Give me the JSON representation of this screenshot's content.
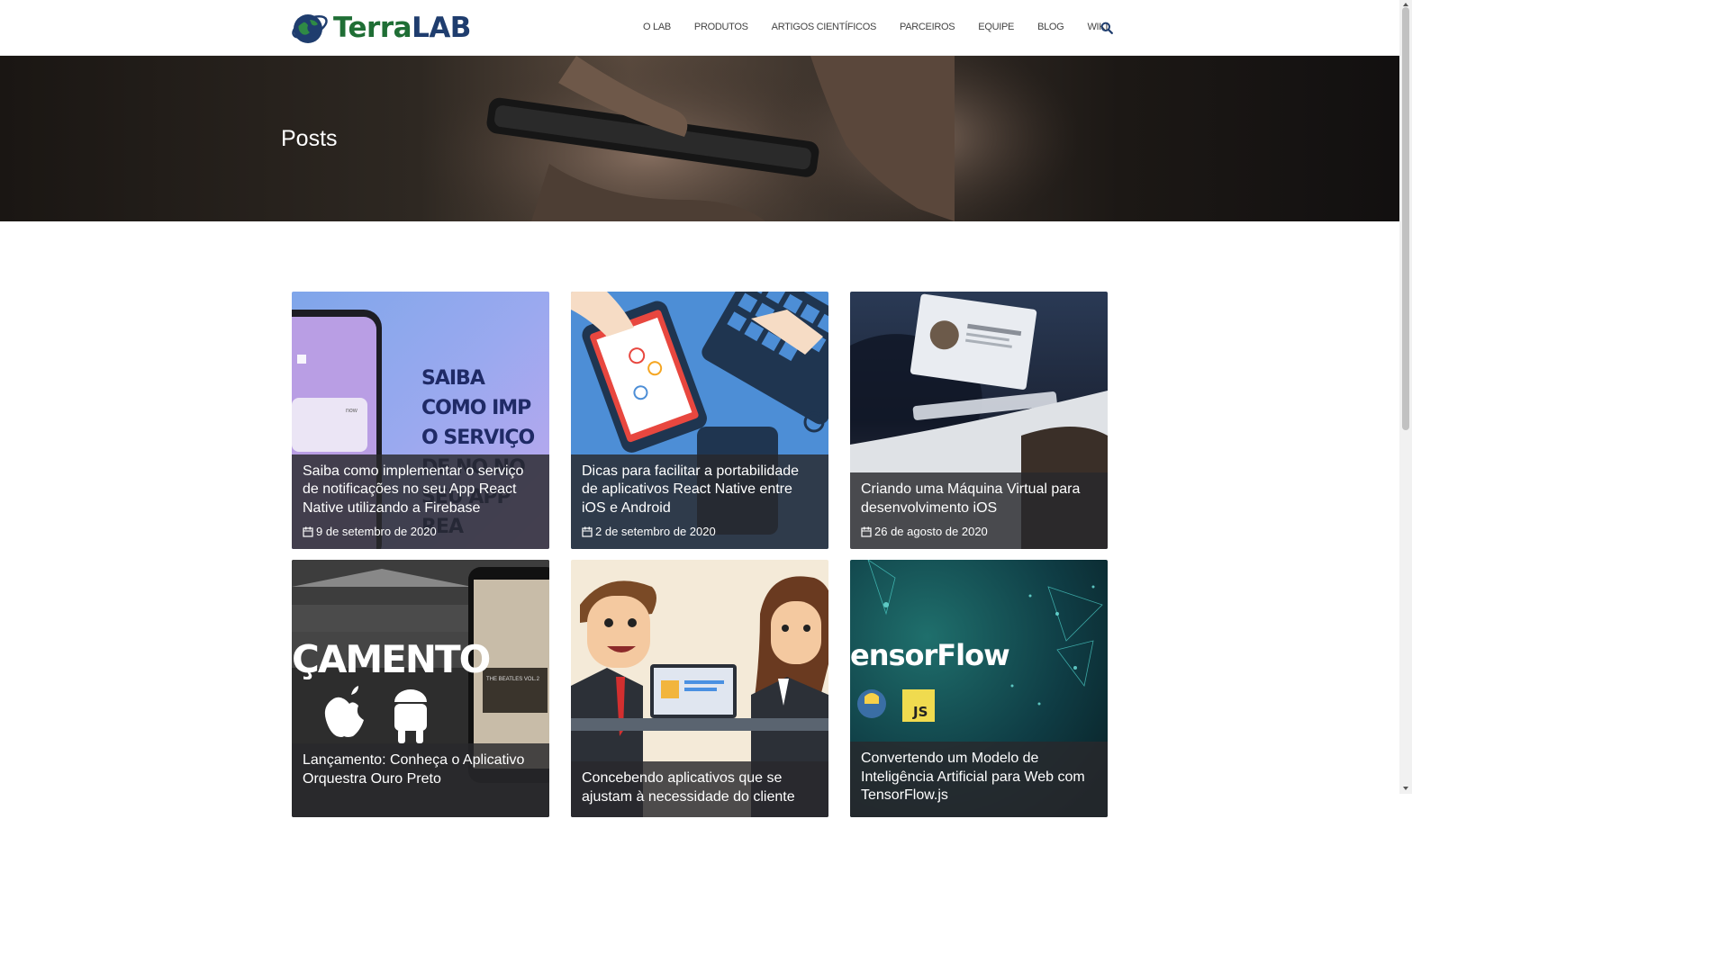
{
  "brand": {
    "part1": "Terra",
    "part2": "LAB"
  },
  "nav": {
    "items": [
      "O LAB",
      "PRODUTOS",
      "ARTIGOS CIENTÍFICOS",
      "PARCEIROS",
      "EQUIPE",
      "BLOG",
      "WIKI"
    ]
  },
  "hero": {
    "title": "Posts"
  },
  "posts": [
    {
      "title": "Saiba como implementar o serviço de notificações no seu App React Native utilizando a Firebase",
      "date": "9 de setembro de 2020",
      "image_text": "SAIBA COMO IMP O SERVIÇO DE NO NO SEU APP REA"
    },
    {
      "title": "Dicas para facilitar a portabilidade de aplicativos React Native entre iOS e Android",
      "date": "2 de setembro de 2020"
    },
    {
      "title": "Criando uma Máquina Virtual para desenvolvimento iOS",
      "date": "26 de agosto de 2020"
    },
    {
      "title": "Lançamento: Conheça o Aplicativo Orquestra Ouro Preto",
      "date": "",
      "image_text": "ÇAMENTO"
    },
    {
      "title": "Concebendo aplicativos que se ajustam à necessidade do cliente",
      "date": ""
    },
    {
      "title": "Convertendo um Modelo de Inteligência Artificial para Web com TensorFlow.js",
      "date": "",
      "image_text": "ensorFlow"
    }
  ],
  "colors": {
    "brand_green": "#1f6e35",
    "brand_blue": "#1f3d6e",
    "caption_bg": "#28282c"
  }
}
